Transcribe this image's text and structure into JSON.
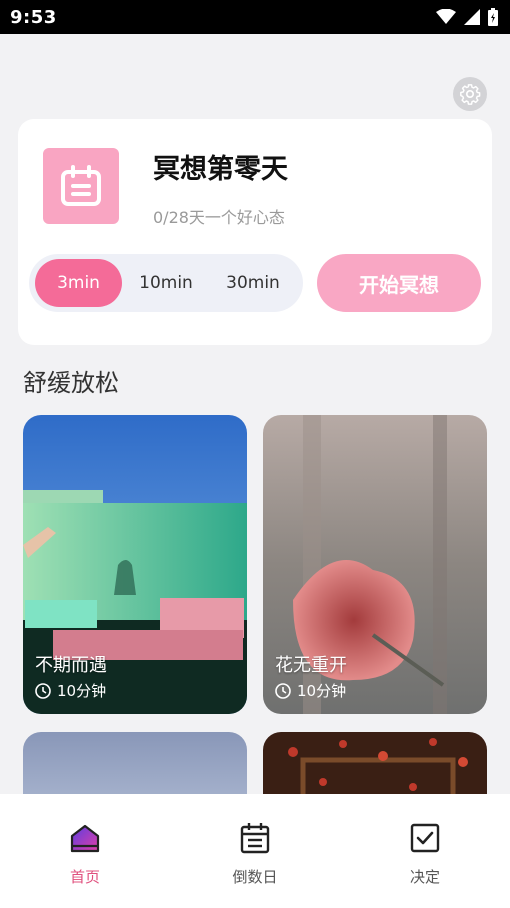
{
  "status_bar": {
    "time": "9:53"
  },
  "hero": {
    "title": "冥想第零天",
    "subtitle": "0/28天一个好心态",
    "durations": [
      "3min",
      "10min",
      "30min"
    ],
    "selected_duration": "3min",
    "start_label": "开始冥想"
  },
  "section": {
    "title": "舒缓放松"
  },
  "cards": [
    {
      "title": "不期而遇",
      "duration": "10分钟"
    },
    {
      "title": "花无重开",
      "duration": "10分钟"
    }
  ],
  "nav": {
    "items": [
      {
        "label": "首页",
        "icon": "home-icon",
        "active": true
      },
      {
        "label": "倒数日",
        "icon": "calendar-list-icon",
        "active": false
      },
      {
        "label": "决定",
        "icon": "checkbox-icon",
        "active": false
      }
    ]
  },
  "colors": {
    "accent": "#f46b98",
    "accent_light": "#f9a7c4",
    "nav_active": "#e0507e"
  }
}
